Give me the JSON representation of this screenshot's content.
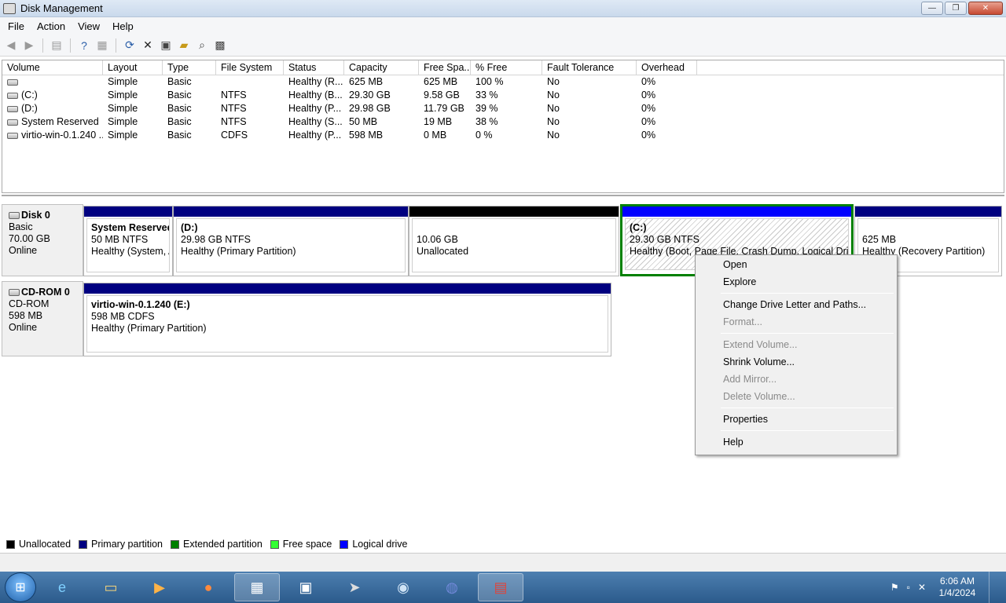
{
  "window": {
    "title": "Disk Management",
    "buttons": {
      "minimize": "—",
      "restore": "❐",
      "close": "✕"
    }
  },
  "menu": [
    "File",
    "Action",
    "View",
    "Help"
  ],
  "toolbar": {
    "icons": [
      "back-icon",
      "forward-icon",
      "console-tree-icon",
      "help-icon",
      "properties-pane-icon",
      "refresh-icon",
      "delete-icon",
      "properties-icon",
      "open-icon",
      "explore-icon",
      "settings-icon"
    ]
  },
  "volume_table": {
    "columns": [
      "Volume",
      "Layout",
      "Type",
      "File System",
      "Status",
      "Capacity",
      "Free Spa...",
      "% Free",
      "Fault Tolerance",
      "Overhead"
    ],
    "rows": [
      [
        "",
        "Simple",
        "Basic",
        "",
        "Healthy (R...",
        "625 MB",
        "625 MB",
        "100 %",
        "No",
        "0%"
      ],
      [
        "(C:)",
        "Simple",
        "Basic",
        "NTFS",
        "Healthy (B...",
        "29.30 GB",
        "9.58 GB",
        "33 %",
        "No",
        "0%"
      ],
      [
        "(D:)",
        "Simple",
        "Basic",
        "NTFS",
        "Healthy (P...",
        "29.98 GB",
        "11.79 GB",
        "39 %",
        "No",
        "0%"
      ],
      [
        "System Reserved",
        "Simple",
        "Basic",
        "NTFS",
        "Healthy (S...",
        "50 MB",
        "19 MB",
        "38 %",
        "No",
        "0%"
      ],
      [
        "virtio-win-0.1.240 ...",
        "Simple",
        "Basic",
        "CDFS",
        "Healthy (P...",
        "598 MB",
        "0 MB",
        "0 %",
        "No",
        "0%"
      ]
    ]
  },
  "disks": [
    {
      "name": "Disk 0",
      "type": "Basic",
      "size": "70.00 GB",
      "state": "Online",
      "partitions": [
        {
          "name": "System Reserved",
          "size": "50 MB NTFS",
          "status": "Healthy (System, A"
        },
        {
          "name": "(D:)",
          "size": "29.98 GB NTFS",
          "status": "Healthy (Primary Partition)"
        },
        {
          "name": "",
          "size": "10.06 GB",
          "status": "Unallocated"
        },
        {
          "name": "(C:)",
          "size": "29.30 GB NTFS",
          "status": "Healthy (Boot, Page File, Crash Dump, Logical Drive)"
        },
        {
          "name": "",
          "size": "625 MB",
          "status": "Healthy (Recovery Partition)"
        }
      ]
    },
    {
      "name": "CD-ROM 0",
      "type": "CD-ROM",
      "size": "598 MB",
      "state": "Online",
      "partitions": [
        {
          "name": "virtio-win-0.1.240  (E:)",
          "size": "598 MB CDFS",
          "status": "Healthy (Primary Partition)"
        }
      ]
    }
  ],
  "legend": [
    {
      "label": "Unallocated",
      "color": "#000000"
    },
    {
      "label": "Primary partition",
      "color": "#000080"
    },
    {
      "label": "Extended partition",
      "color": "#008000"
    },
    {
      "label": "Free space",
      "color": "#33ff33"
    },
    {
      "label": "Logical drive",
      "color": "#0000ff"
    }
  ],
  "context_menu": {
    "items": [
      "Open",
      "Explore",
      "Change Drive Letter and Paths...",
      "Format...",
      "Extend Volume...",
      "Shrink Volume...",
      "Add Mirror...",
      "Delete Volume...",
      "Properties",
      "Help"
    ]
  },
  "taskbar": {
    "apps": [
      "internet-explorer-icon",
      "file-explorer-icon",
      "media-player-icon",
      "firefox-icon",
      "control-panel-icon",
      "image-viewer-icon",
      "rocket-app-icon",
      "steam-icon",
      "discord-icon",
      "toolbox-icon"
    ],
    "time": "6:06 AM",
    "date": "1/4/2024"
  },
  "colors": {
    "primary": "#000080",
    "logical": "#0000ff",
    "extended": "#008000",
    "unallocated": "#000000"
  }
}
